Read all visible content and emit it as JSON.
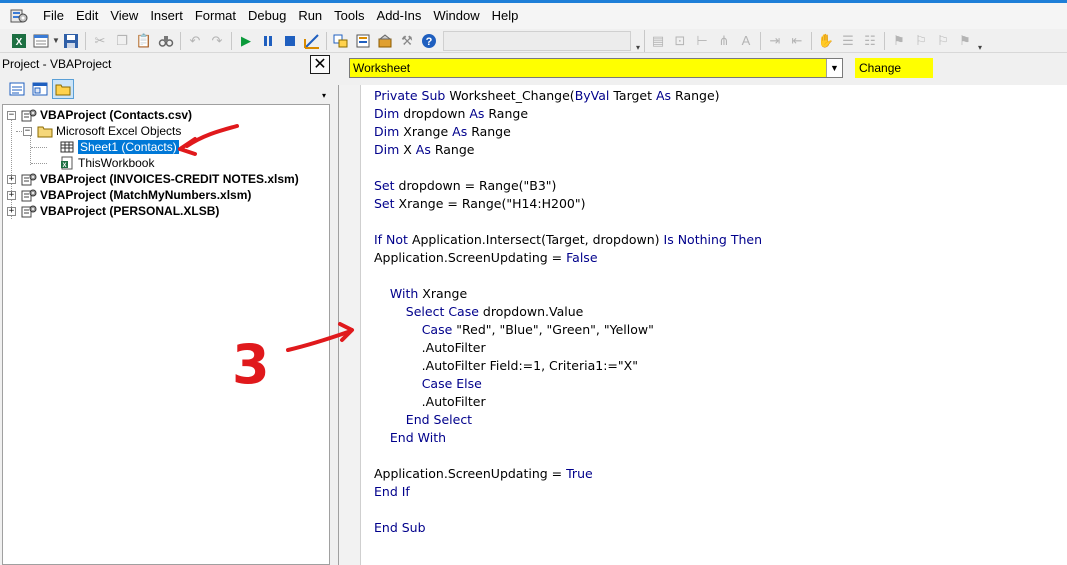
{
  "menu": {
    "logo_icon": "vbe-app-icon",
    "items": [
      "File",
      "Edit",
      "View",
      "Insert",
      "Format",
      "Debug",
      "Run",
      "Tools",
      "Add-Ins",
      "Window",
      "Help"
    ]
  },
  "toolbar": {
    "buttons": [
      "excel-view-icon",
      "insert-module-icon",
      "save-icon",
      "cut-icon",
      "copy-icon",
      "paste-icon",
      "find-icon",
      "undo-icon",
      "redo-icon",
      "run-icon",
      "break-icon",
      "reset-icon",
      "design-mode-icon",
      "project-explorer-icon",
      "properties-icon",
      "object-browser-icon",
      "toolbox-icon",
      "help-icon"
    ]
  },
  "project_panel": {
    "title": "Project - VBAProject",
    "close_label": "✕",
    "tree": [
      {
        "label": "VBAProject (Contacts.csv)",
        "bold": true,
        "expanded": true
      },
      {
        "label": "Microsoft Excel Objects",
        "bold": false,
        "expanded": true
      },
      {
        "label": "Sheet1 (Contacts)",
        "bold": false,
        "selected": true
      },
      {
        "label": "ThisWorkbook",
        "bold": false
      },
      {
        "label": "VBAProject (INVOICES-CREDIT NOTES.xlsm)",
        "bold": true,
        "expanded": false
      },
      {
        "label": "VBAProject (MatchMyNumbers.xlsm)",
        "bold": true,
        "expanded": false
      },
      {
        "label": "VBAProject (PERSONAL.XLSB)",
        "bold": true,
        "expanded": false
      }
    ]
  },
  "code_window": {
    "object_combo": "Worksheet",
    "procedure_combo": "Change",
    "highlight_color": "#ffff00",
    "keyword_color": "#00008b",
    "lines": [
      [
        {
          "t": "Private Sub ",
          "k": true
        },
        {
          "t": "Worksheet_Change(",
          "k": false
        },
        {
          "t": "ByVal",
          "k": true
        },
        {
          "t": " Target ",
          "k": false
        },
        {
          "t": "As",
          "k": true
        },
        {
          "t": " Range)",
          "k": false
        }
      ],
      [
        {
          "t": "Dim",
          "k": true
        },
        {
          "t": " dropdown ",
          "k": false
        },
        {
          "t": "As",
          "k": true
        },
        {
          "t": " Range",
          "k": false
        }
      ],
      [
        {
          "t": "Dim",
          "k": true
        },
        {
          "t": " Xrange ",
          "k": false
        },
        {
          "t": "As",
          "k": true
        },
        {
          "t": " Range",
          "k": false
        }
      ],
      [
        {
          "t": "Dim",
          "k": true
        },
        {
          "t": " X ",
          "k": false
        },
        {
          "t": "As",
          "k": true
        },
        {
          "t": " Range",
          "k": false
        }
      ],
      [],
      [
        {
          "t": "Set",
          "k": true
        },
        {
          "t": " dropdown = Range(\"B3\")",
          "k": false
        }
      ],
      [
        {
          "t": "Set",
          "k": true
        },
        {
          "t": " Xrange = Range(\"H14:H200\")",
          "k": false
        }
      ],
      [],
      [
        {
          "t": "If Not",
          "k": true
        },
        {
          "t": " Application.Intersect(Target, dropdown) ",
          "k": false
        },
        {
          "t": "Is Nothing Then",
          "k": true
        }
      ],
      [
        {
          "t": "Application.ScreenUpdating = ",
          "k": false
        },
        {
          "t": "False",
          "k": true
        }
      ],
      [],
      [
        {
          "t": "    ",
          "k": false
        },
        {
          "t": "With",
          "k": true
        },
        {
          "t": " Xrange",
          "k": false
        }
      ],
      [
        {
          "t": "        ",
          "k": false
        },
        {
          "t": "Select Case",
          "k": true
        },
        {
          "t": " dropdown.Value",
          "k": false
        }
      ],
      [
        {
          "t": "            ",
          "k": false
        },
        {
          "t": "Case",
          "k": true
        },
        {
          "t": " \"Red\", \"Blue\", \"Green\", \"Yellow\"",
          "k": false
        }
      ],
      [
        {
          "t": "            .AutoFilter",
          "k": false
        }
      ],
      [
        {
          "t": "            .AutoFilter Field:=1, Criteria1:=\"X\"",
          "k": false
        }
      ],
      [
        {
          "t": "            ",
          "k": false
        },
        {
          "t": "Case Else",
          "k": true
        }
      ],
      [
        {
          "t": "            .AutoFilter",
          "k": false
        }
      ],
      [
        {
          "t": "        ",
          "k": false
        },
        {
          "t": "End Select",
          "k": true
        }
      ],
      [
        {
          "t": "    ",
          "k": false
        },
        {
          "t": "End With",
          "k": true
        }
      ],
      [],
      [
        {
          "t": "Application.ScreenUpdating = ",
          "k": false
        },
        {
          "t": "True",
          "k": true
        }
      ],
      [
        {
          "t": "End If",
          "k": true
        }
      ],
      [],
      [
        {
          "t": "End Sub",
          "k": true
        }
      ]
    ]
  },
  "annotations": {
    "step_number": "3",
    "ink_color": "#e0191c"
  }
}
